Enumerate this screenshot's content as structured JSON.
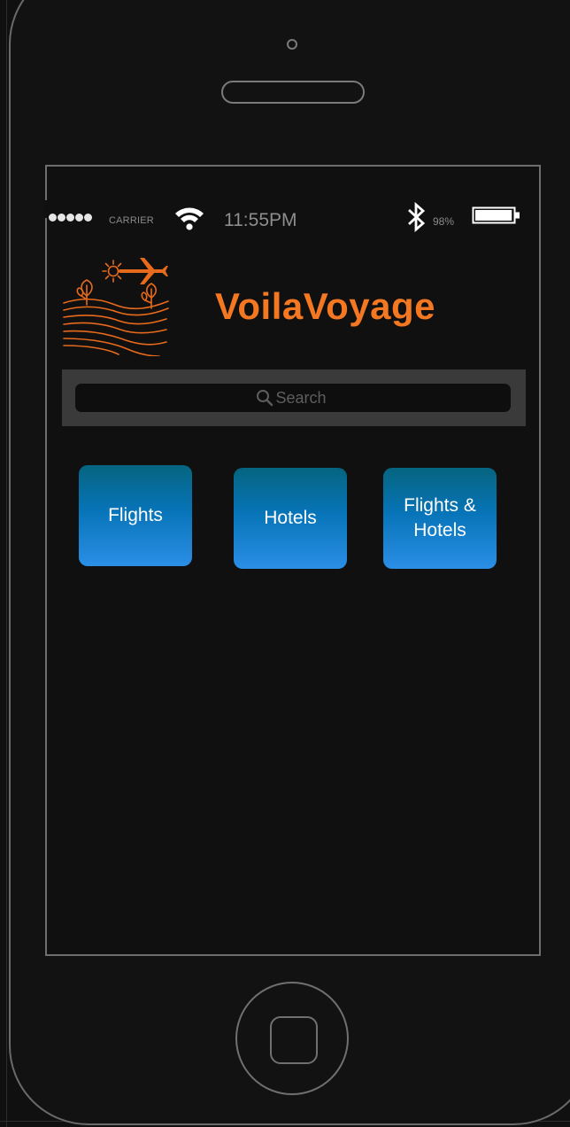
{
  "status_bar": {
    "carrier": "CARRIER",
    "time": "11:55PM",
    "battery_percent": "98%",
    "battery_level": 0.98,
    "signal_bars": 5
  },
  "app": {
    "brand_name": "VoilaVoyage",
    "brand_color": "#f47722",
    "logo_icon": "farm-plane-sun-logo"
  },
  "search": {
    "placeholder": "Search",
    "value": "",
    "icon": "search-icon"
  },
  "categories": [
    {
      "label": "Flights"
    },
    {
      "label": "Hotels"
    },
    {
      "label": "Flights & Hotels"
    }
  ],
  "colors": {
    "tile_gradient_top": "#05647f",
    "tile_gradient_bottom": "#2b8fe6",
    "background": "#101010"
  }
}
